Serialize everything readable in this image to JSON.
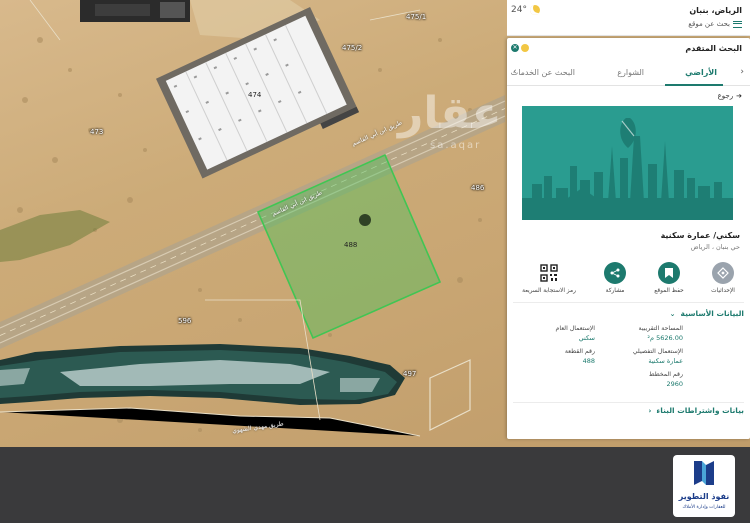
{
  "map": {
    "plots": {
      "p475_1": "475/1",
      "p475_2": "475/2",
      "p474": "474",
      "p473": "473",
      "p486": "486",
      "p488": "488",
      "p596": "596",
      "p497": "497"
    },
    "road_labels": {
      "upper": "طريق ابن أبي القاسم",
      "lower": "طريق ابن أبي القاسم",
      "bottom": "طريق مهدي الشهوي"
    },
    "watermark": "عقار",
    "watermark_sub": "sa.aqar"
  },
  "topbar": {
    "temperature": "24°",
    "city": "الرياض، بنبان",
    "location_search": "بحث عن موقع"
  },
  "panel": {
    "title": "البحث المتقدم",
    "close_glyph": "✕",
    "tabs": [
      {
        "label": "الأراضي",
        "active": true
      },
      {
        "label": "الشوارع",
        "active": false
      },
      {
        "label": "البحث عن الخدمات",
        "active": false
      }
    ],
    "back_label": "رجوع",
    "property_type": "سكني/ عمارة سكنية",
    "district": "حي بنبان ، الرياض",
    "actions": [
      {
        "label": "الإحداثيات",
        "icon": "coordinates-icon",
        "color": "#9aa3ad"
      },
      {
        "label": "حفظ الموقع",
        "icon": "bookmark-icon",
        "color": "#1d7a6e"
      },
      {
        "label": "مشاركة",
        "icon": "share-icon",
        "color": "#1d7a6e"
      },
      {
        "label": "رمز الاستجابة السريعة",
        "icon": "qr-code-icon",
        "color": "#ffffff"
      }
    ],
    "basic_section": "البيانات الأساسية",
    "fields": {
      "area_label": "المساحة التقريبية",
      "area_value": "5626.00 م²",
      "general_use_label": "الإستعمال العام",
      "general_use_value": "سكني",
      "detailed_use_label": "الإستعمال التفصيلي",
      "detailed_use_value": "عمارة سكنية",
      "plot_label": "رقم القطعة",
      "plot_value": "488",
      "plan_label": "رقم المخطط",
      "plan_value": "2960"
    },
    "building_section": "بيانات واشتراطات البناء"
  },
  "brand": {
    "name": "نفوذ التطوير",
    "subtitle": "للعقارات وإدارة الأملاك",
    "color": "#1c3d8a"
  },
  "colors": {
    "accent": "#1d7a6e",
    "hero": "#2a9c90",
    "plot_highlight": "#47c25a"
  }
}
